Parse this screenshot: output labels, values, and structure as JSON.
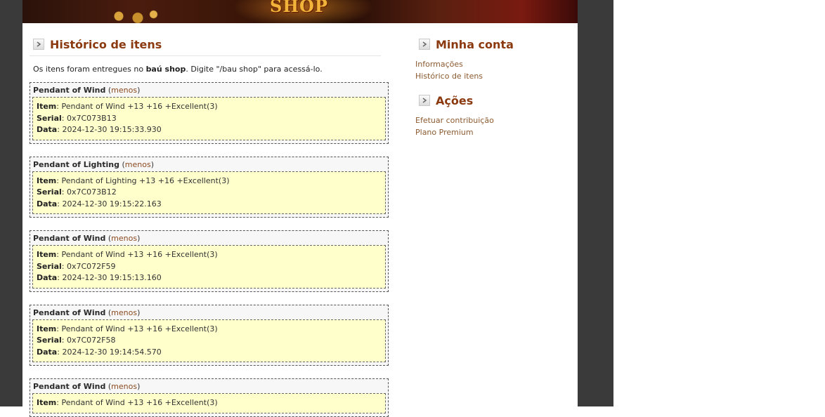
{
  "banner": {
    "title": "SHOP"
  },
  "main": {
    "section_title": "Histórico de itens",
    "notice": {
      "prefix": "Os itens foram entregues no ",
      "bold": "baú shop",
      "suffix": ". Digite \"/bau shop\" para acessá-lo."
    },
    "labels": {
      "item": "Item",
      "serial": "Serial",
      "data": "Data",
      "less": "menos"
    },
    "entries": [
      {
        "name": "Pendant of Wind",
        "item": "Pendant of Wind +13 +16 +Excellent(3)",
        "serial": "0x7C073B13",
        "date": "2024-12-30 19:15:33.930"
      },
      {
        "name": "Pendant of Lighting",
        "item": "Pendant of Lighting +13 +16 +Excellent(3)",
        "serial": "0x7C073B12",
        "date": "2024-12-30 19:15:22.163"
      },
      {
        "name": "Pendant of Wind",
        "item": "Pendant of Wind +13 +16 +Excellent(3)",
        "serial": "0x7C072F59",
        "date": "2024-12-30 19:15:13.160"
      },
      {
        "name": "Pendant of Wind",
        "item": "Pendant of Wind +13 +16 +Excellent(3)",
        "serial": "0x7C072F58",
        "date": "2024-12-30 19:14:54.570"
      },
      {
        "name": "Pendant of Wind",
        "item": "Pendant of Wind +13 +16 +Excellent(3)",
        "serial": "",
        "date": ""
      }
    ]
  },
  "sidebar": {
    "account_title": "Minha conta",
    "account_links": [
      "Informações",
      "Histórico de itens"
    ],
    "actions_title": "Ações",
    "action_links": [
      "Efetuar contribuição",
      "Plano Premium"
    ]
  },
  "colors": {
    "accent": "#8b3a10",
    "link": "#8b5a30",
    "entry_bg": "#ffffcc",
    "gutter": "#3a3a3a"
  }
}
